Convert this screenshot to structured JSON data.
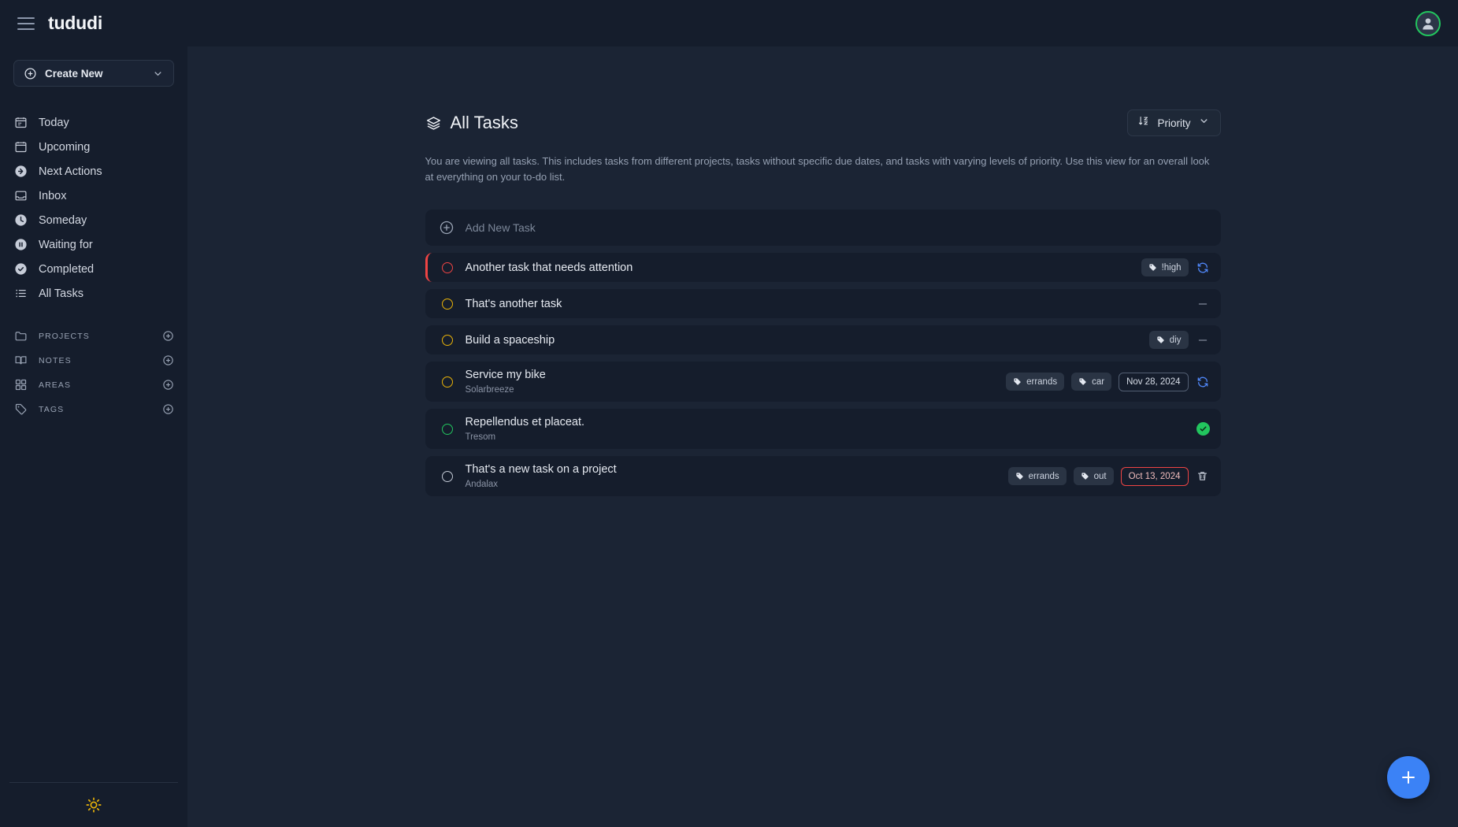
{
  "app": {
    "brand": "tududi",
    "menu_icon": "hamburger-icon",
    "avatar_icon": "user-avatar-icon"
  },
  "sidebar": {
    "create_new": {
      "label": "Create New",
      "icon": "plus-circle-icon",
      "chevron": "chevron-down-icon"
    },
    "nav_items": [
      {
        "label": "Today",
        "icon": "calendar-today-icon"
      },
      {
        "label": "Upcoming",
        "icon": "calendar-icon"
      },
      {
        "label": "Next Actions",
        "icon": "arrow-right-circle-icon"
      },
      {
        "label": "Inbox",
        "icon": "inbox-icon"
      },
      {
        "label": "Someday",
        "icon": "clock-icon"
      },
      {
        "label": "Waiting for",
        "icon": "pause-circle-icon"
      },
      {
        "label": "Completed",
        "icon": "check-circle-icon"
      },
      {
        "label": "All Tasks",
        "icon": "list-icon"
      }
    ],
    "sections": [
      {
        "label": "PROJECTS",
        "icon": "folder-icon",
        "add_icon": "plus-circle-icon"
      },
      {
        "label": "NOTES",
        "icon": "book-open-icon",
        "add_icon": "plus-circle-icon"
      },
      {
        "label": "AREAS",
        "icon": "squares-grid-icon",
        "add_icon": "plus-circle-icon"
      },
      {
        "label": "TAGS",
        "icon": "tag-icon",
        "add_icon": "plus-circle-icon"
      }
    ],
    "theme_toggle": {
      "icon": "sun-icon"
    }
  },
  "main": {
    "title": "All Tasks",
    "title_icon": "layers-icon",
    "sort": {
      "label": "Priority",
      "icon": "sort-az-icon",
      "chevron": "chevron-down-icon"
    },
    "description": "You are viewing all tasks. This includes tasks from different projects, tasks without specific due dates, and tasks with varying levels of priority. Use this view for an overall look at everything on your to-do list.",
    "add_task": {
      "placeholder": "Add New Task",
      "value": "",
      "icon": "plus-circle-icon"
    },
    "fab": {
      "icon": "plus-icon",
      "color": "#3b82f6"
    },
    "tasks": [
      {
        "name": "Another task that needs attention",
        "project": "",
        "check_color": "#ef4444",
        "accent": "#ef4444",
        "tags": [
          {
            "label": "!high"
          }
        ],
        "date": "",
        "date_overdue": false,
        "action": "refresh-icon"
      },
      {
        "name": "That's another task",
        "project": "",
        "check_color": "#eab308",
        "accent": "transparent",
        "tags": [],
        "date": "",
        "date_overdue": false,
        "action": "dash-icon"
      },
      {
        "name": "Build a spaceship",
        "project": "",
        "check_color": "#eab308",
        "accent": "transparent",
        "tags": [
          {
            "label": "diy"
          }
        ],
        "date": "",
        "date_overdue": false,
        "action": "dash-icon"
      },
      {
        "name": "Service my bike",
        "project": "Solarbreeze",
        "check_color": "#eab308",
        "accent": "transparent",
        "tags": [
          {
            "label": "errands"
          },
          {
            "label": "car"
          }
        ],
        "date": "Nov 28, 2024",
        "date_overdue": false,
        "action": "refresh-icon"
      },
      {
        "name": "Repellendus et placeat.",
        "project": "Tresom",
        "check_color": "#22c55e",
        "accent": "transparent",
        "tags": [],
        "date": "",
        "date_overdue": false,
        "action": "done-check-icon"
      },
      {
        "name": "That's a new task on a project",
        "project": "Andalax",
        "check_color": "#c3cad6",
        "accent": "transparent",
        "tags": [
          {
            "label": "errands"
          },
          {
            "label": "out"
          }
        ],
        "date": "Oct 13, 2024",
        "date_overdue": true,
        "action": "trash-icon"
      }
    ]
  }
}
